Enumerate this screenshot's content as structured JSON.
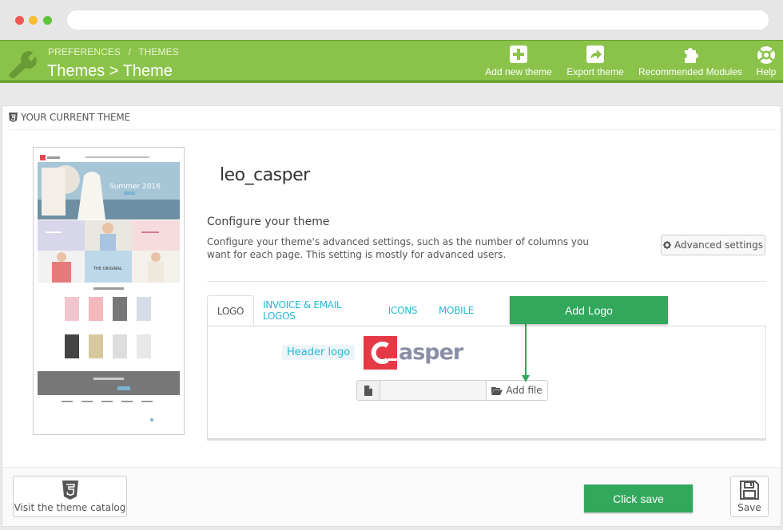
{
  "toolbar": {
    "breadcrumb": [
      "PREFERENCES",
      "/",
      "THEMES"
    ],
    "title": "Themes > Theme",
    "buttons": [
      {
        "label": "Add new theme",
        "icon": "plus-square-icon"
      },
      {
        "label": "Export theme",
        "icon": "share-icon"
      },
      {
        "label": "Recommended Modules",
        "icon": "puzzle-icon"
      },
      {
        "label": "Help",
        "icon": "lifebuoy-icon"
      }
    ],
    "color": "#8bc34a"
  },
  "panel": {
    "heading": "YOUR CURRENT THEME",
    "theme_name": "leo_casper",
    "configure_title": "Configure your theme",
    "configure_desc": "Configure your theme's advanced settings, such as the number of columns you want for each page. This setting is mostly for advanced users.",
    "advanced_button": "Advanced settings",
    "tabs": [
      {
        "label": "LOGO",
        "active": true
      },
      {
        "label": "INVOICE & EMAIL LOGOS",
        "active": false
      },
      {
        "label": "ICONS",
        "active": false
      },
      {
        "label": "MOBILE",
        "active": false
      }
    ],
    "header_logo_label": "Header logo",
    "logo_text": "asper",
    "add_file_button": "Add file"
  },
  "annotations": {
    "add_logo": "Add Logo",
    "click_save": "Click save",
    "color": "#31a85c"
  },
  "footer": {
    "catalog_button": "Visit the theme catalog",
    "save_button": "Save"
  },
  "preview": {
    "banner_text": "Summer 2016",
    "tile_text": "THE ORIGINAL"
  }
}
